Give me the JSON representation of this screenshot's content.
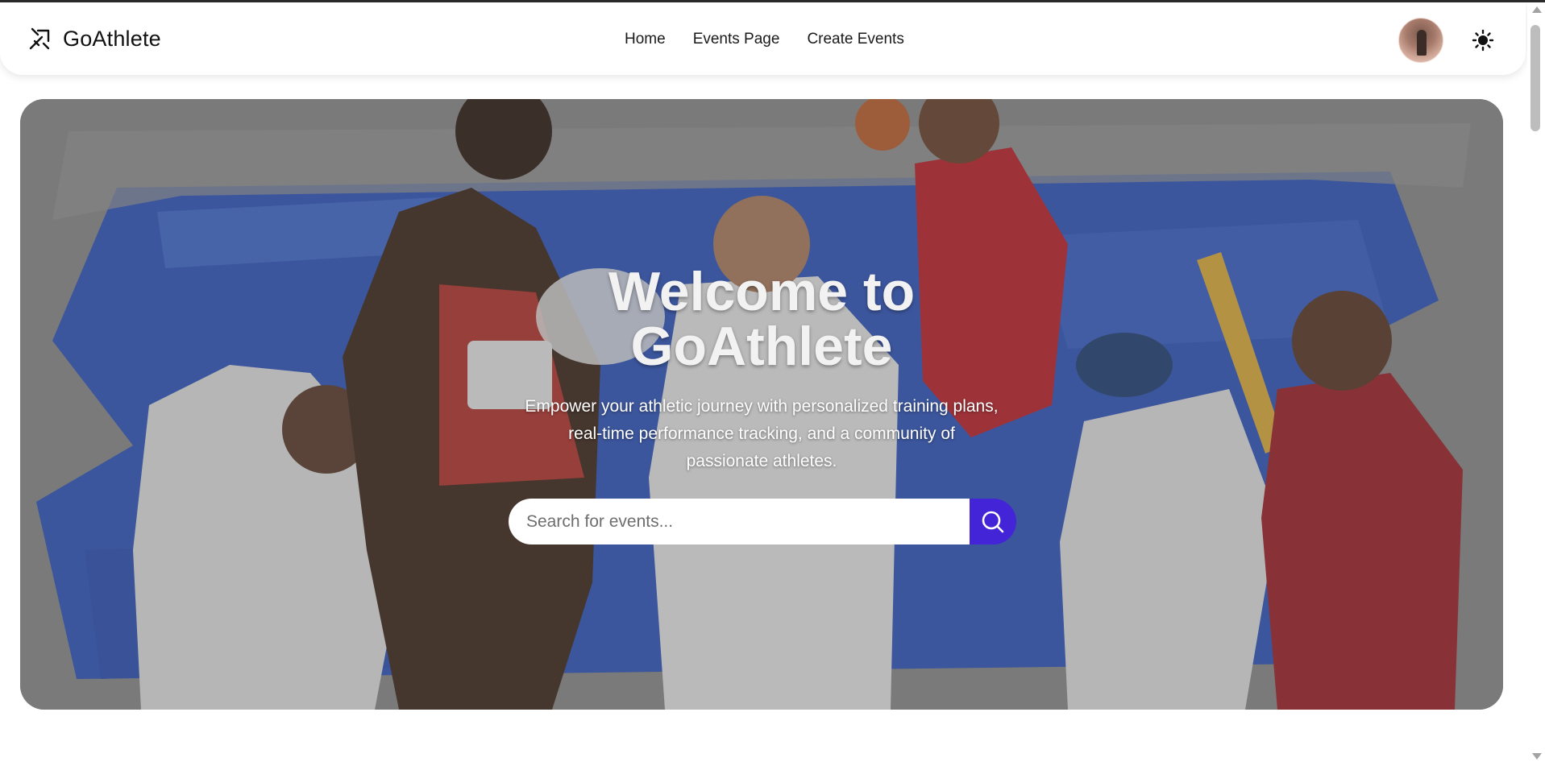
{
  "brand": {
    "name": "GoAthlete",
    "icon": "sprint-arrows-icon"
  },
  "nav": {
    "links": [
      {
        "label": "Home"
      },
      {
        "label": "Events Page"
      },
      {
        "label": "Create Events"
      }
    ]
  },
  "header_actions": {
    "avatar": "user-avatar",
    "theme_icon": "sun-icon"
  },
  "hero": {
    "title_line1": "Welcome to",
    "title_line2": "GoAthlete",
    "subtitle_line1": "Empower your athletic journey with personalized training plans,",
    "subtitle_line2": "real-time performance tracking, and a community of",
    "subtitle_line3": "passionate athletes.",
    "search": {
      "placeholder": "Search for events...",
      "value": "",
      "button_icon": "search-icon"
    }
  },
  "colors": {
    "accent": "#4324d6",
    "brush_blue": "#2a57c8",
    "overlay": "#5a5a5a"
  }
}
